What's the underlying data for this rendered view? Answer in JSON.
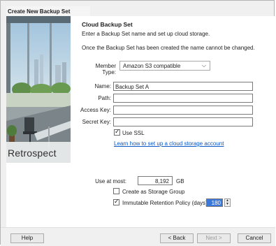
{
  "window": {
    "title": "Create New Backup Set"
  },
  "brand": {
    "name": "Retrospect"
  },
  "form": {
    "heading": "Cloud Backup Set",
    "description1": "Enter a Backup Set name and set up cloud storage.",
    "description2": "Once the Backup Set has been created the name cannot be changed.",
    "member_type": {
      "label": "Member Type:",
      "value": "Amazon S3 compatible"
    },
    "name": {
      "label": "Name:",
      "value": "Backup Set A"
    },
    "path": {
      "label": "Path:",
      "value": ""
    },
    "access_key": {
      "label": "Access Key:",
      "value": ""
    },
    "secret_key": {
      "label": "Secret Key:",
      "value": ""
    },
    "use_ssl": {
      "label": "Use SSL",
      "checked": true
    },
    "help_link": "Learn how to set up a cloud storage account",
    "use_at_most": {
      "label": "Use at most:",
      "value": "8,192",
      "unit": "GB"
    },
    "storage_group": {
      "label": "Create as Storage Group",
      "checked": false
    },
    "immutable": {
      "label": "Immutable Retention Policy (days)",
      "checked": true,
      "days": "180"
    }
  },
  "buttons": {
    "help": "Help",
    "back": "< Back",
    "next": "Next >",
    "cancel": "Cancel"
  },
  "colors": {
    "link": "#0b55c4",
    "selection": "#3c78d8"
  }
}
